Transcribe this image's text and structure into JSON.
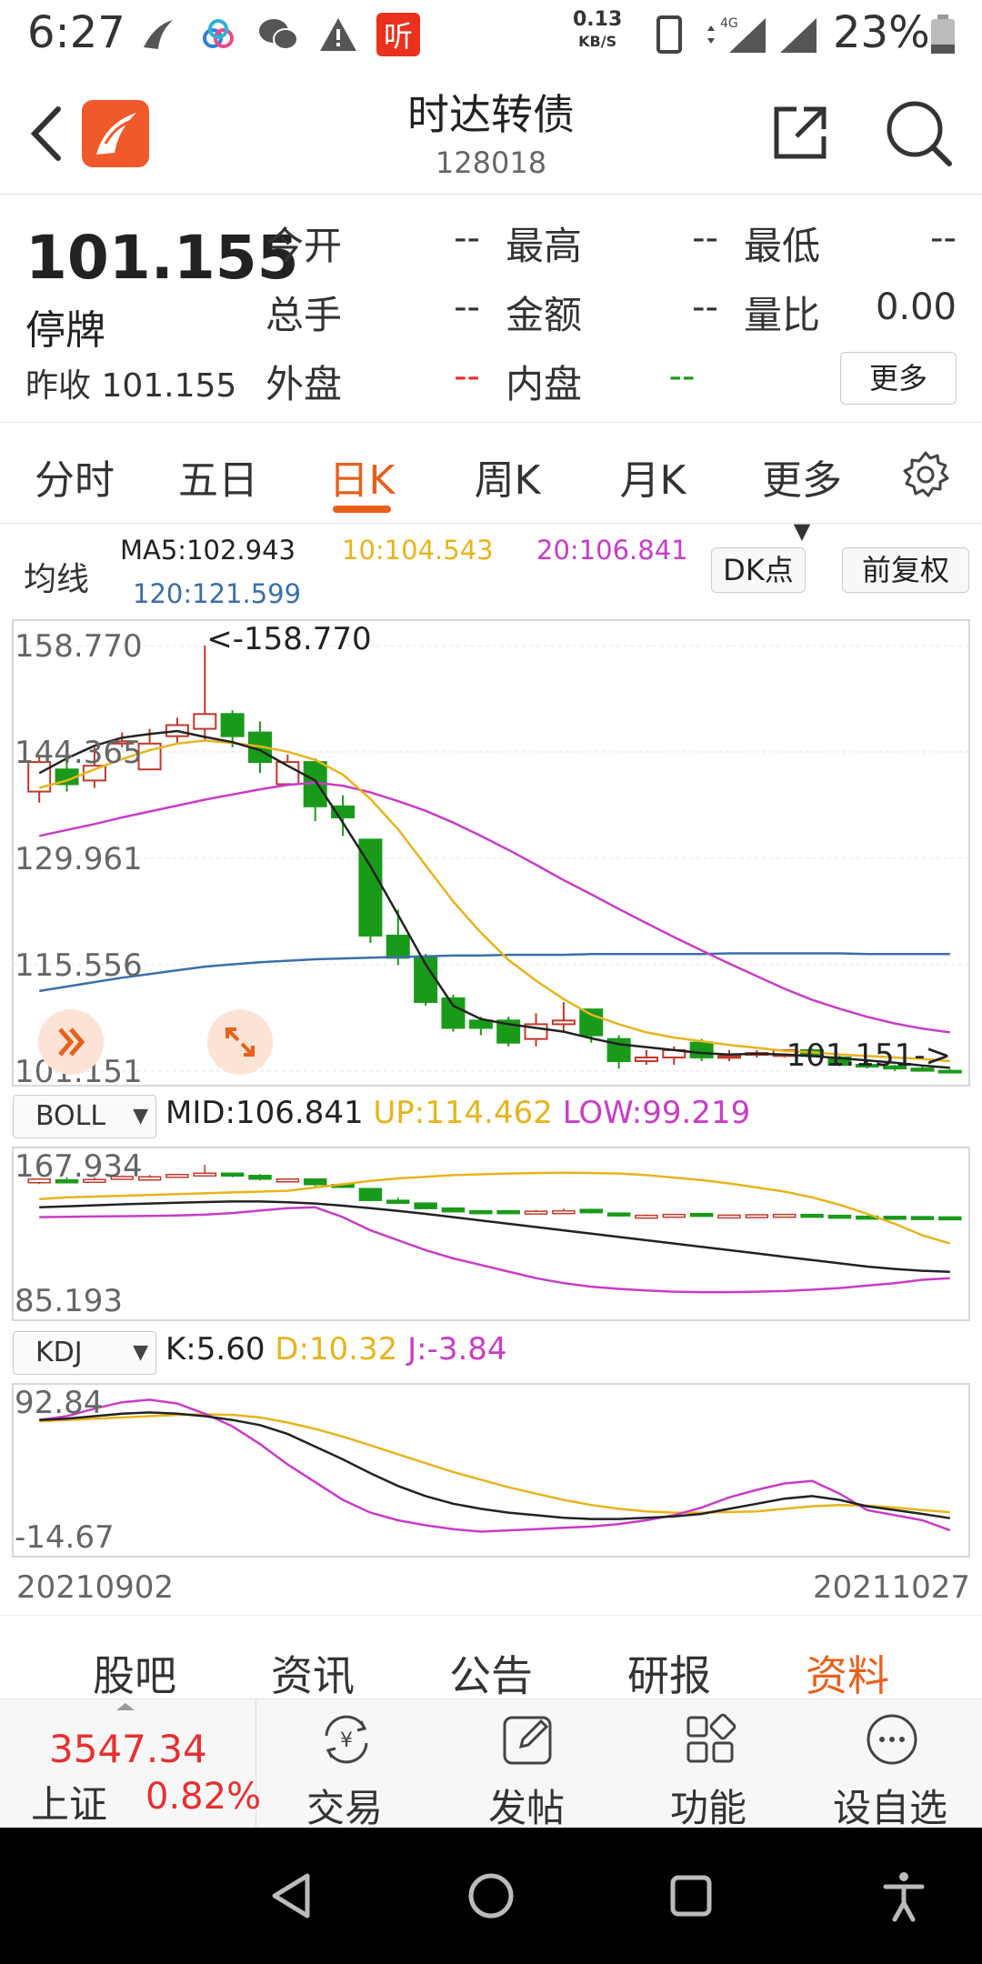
{
  "status_bar": {
    "time": "6:27",
    "notif_ting": "听",
    "net_speed_value": "0.13",
    "net_speed_unit": "KB/S",
    "network": "4G",
    "battery": "23%"
  },
  "header": {
    "title": "时达转债",
    "code": "128018"
  },
  "quote": {
    "price": "101.155",
    "status": "停牌",
    "prev_close_label": "昨收",
    "prev_close_value": "101.155",
    "fields": [
      {
        "label": "今开",
        "value": "--"
      },
      {
        "label": "最高",
        "value": "--"
      },
      {
        "label": "最低",
        "value": "--"
      },
      {
        "label": "总手",
        "value": "--"
      },
      {
        "label": "金额",
        "value": "--"
      },
      {
        "label": "量比",
        "value": "0.00"
      },
      {
        "label": "外盘",
        "value": "--"
      },
      {
        "label": "内盘",
        "value": "--"
      }
    ],
    "more_label": "更多"
  },
  "period_tabs": {
    "items": [
      "分时",
      "五日",
      "日K",
      "周K",
      "月K",
      "更多"
    ],
    "active": "日K"
  },
  "ma_legend": {
    "label": "均线",
    "ma5": "MA5:102.943",
    "ma10": "10:104.543",
    "ma20": "20:106.841",
    "ma120": "120:121.599",
    "dk_button": "DK点",
    "adjust_button": "前复权"
  },
  "colors": {
    "up": "#c0392b",
    "down": "#1a9a1a",
    "ma5": "#222222",
    "ma10": "#e8b41c",
    "ma20": "#c83cc8",
    "ma120": "#3b6fa8",
    "accent": "#e8601c"
  },
  "chart_data": [
    {
      "type": "candlestick",
      "name_label": "main",
      "y_ticks": [
        "158.770",
        "144.365",
        "129.961",
        "115.556",
        "101.151"
      ],
      "ylim": [
        101.151,
        158.77
      ],
      "max_annotation": "<-158.770",
      "min_annotation": "101.151->",
      "candles": [
        {
          "o": 139.0,
          "h": 144.0,
          "l": 137.5,
          "c": 143.0
        },
        {
          "o": 142.0,
          "h": 145.2,
          "l": 139.0,
          "c": 140.0
        },
        {
          "o": 140.5,
          "h": 145.0,
          "l": 139.5,
          "c": 142.5
        },
        {
          "o": 145.5,
          "h": 147.0,
          "l": 145.0,
          "c": 145.8
        },
        {
          "o": 142.0,
          "h": 147.5,
          "l": 142.0,
          "c": 145.5
        },
        {
          "o": 146.5,
          "h": 149.0,
          "l": 145.5,
          "c": 148.0
        },
        {
          "o": 147.5,
          "h": 158.77,
          "l": 146.0,
          "c": 149.5
        },
        {
          "o": 149.5,
          "h": 150.0,
          "l": 145.0,
          "c": 146.5
        },
        {
          "o": 147.0,
          "h": 148.5,
          "l": 141.5,
          "c": 143.0
        },
        {
          "o": 140.0,
          "h": 144.0,
          "l": 140.0,
          "c": 143.0
        },
        {
          "o": 143.0,
          "h": 143.5,
          "l": 135.0,
          "c": 137.0
        },
        {
          "o": 137.0,
          "h": 138.5,
          "l": 133.0,
          "c": 135.5
        },
        {
          "o": 132.5,
          "h": 132.5,
          "l": 118.5,
          "c": 119.5
        },
        {
          "o": 119.5,
          "h": 123.0,
          "l": 115.5,
          "c": 116.5
        },
        {
          "o": 116.5,
          "h": 117.0,
          "l": 110.0,
          "c": 110.5
        },
        {
          "o": 111.0,
          "h": 111.5,
          "l": 106.5,
          "c": 107.0
        },
        {
          "o": 108.0,
          "h": 108.5,
          "l": 106.0,
          "c": 107.0
        },
        {
          "o": 108.0,
          "h": 108.5,
          "l": 104.5,
          "c": 105.0
        },
        {
          "o": 105.5,
          "h": 109.0,
          "l": 104.5,
          "c": 107.5
        },
        {
          "o": 107.5,
          "h": 110.5,
          "l": 106.5,
          "c": 108.0
        },
        {
          "o": 109.5,
          "h": 109.5,
          "l": 105.0,
          "c": 106.0
        },
        {
          "o": 105.5,
          "h": 106.0,
          "l": 101.5,
          "c": 102.5
        },
        {
          "o": 102.5,
          "h": 104.0,
          "l": 102.0,
          "c": 103.0
        },
        {
          "o": 103.0,
          "h": 104.5,
          "l": 102.0,
          "c": 104.0
        },
        {
          "o": 105.0,
          "h": 105.5,
          "l": 102.5,
          "c": 103.0
        },
        {
          "o": 103.0,
          "h": 104.0,
          "l": 102.5,
          "c": 103.2
        },
        {
          "o": 103.5,
          "h": 104.0,
          "l": 103.0,
          "c": 103.6
        },
        {
          "o": 103.2,
          "h": 104.0,
          "l": 103.0,
          "c": 104.0
        },
        {
          "o": 104.0,
          "h": 104.2,
          "l": 103.0,
          "c": 103.2
        },
        {
          "o": 103.0,
          "h": 103.5,
          "l": 101.8,
          "c": 102.0
        },
        {
          "o": 102.0,
          "h": 102.5,
          "l": 101.5,
          "c": 101.8
        },
        {
          "o": 101.8,
          "h": 102.0,
          "l": 101.2,
          "c": 101.5
        },
        {
          "o": 101.5,
          "h": 101.8,
          "l": 101.151,
          "c": 101.2
        },
        {
          "o": 101.2,
          "h": 101.4,
          "l": 101.151,
          "c": 101.155
        }
      ],
      "ma5": [
        141.5,
        143.5,
        145.2,
        146.3,
        146.8,
        147.2,
        146.4,
        145.7,
        144.6,
        142.5,
        140.5,
        134.8,
        128.9,
        122.3,
        115.6,
        110.0,
        108.2,
        107.5,
        107.0,
        106.5,
        105.6,
        104.8,
        104.4,
        104.0,
        103.6,
        103.4,
        103.5,
        103.4,
        103.2,
        102.9,
        102.6,
        102.3,
        101.9,
        101.6
      ],
      "ma10": [
        139.5,
        140.5,
        142.0,
        143.4,
        144.6,
        145.5,
        145.9,
        145.6,
        145.1,
        144.4,
        143.3,
        141.3,
        138.0,
        133.9,
        129.0,
        124.1,
        119.9,
        116.2,
        113.4,
        110.9,
        108.8,
        107.5,
        106.4,
        105.7,
        105.2,
        104.7,
        104.3,
        103.9,
        103.7,
        103.4,
        103.2,
        103.0,
        102.8,
        102.5
      ],
      "ma20": [
        133.0,
        133.8,
        134.6,
        135.5,
        136.3,
        137.1,
        137.9,
        138.6,
        139.3,
        139.9,
        140.2,
        139.8,
        138.9,
        137.7,
        136.4,
        134.8,
        133.0,
        131.1,
        129.1,
        127.0,
        125.1,
        123.1,
        121.2,
        119.3,
        117.5,
        115.7,
        114.0,
        112.3,
        110.8,
        109.6,
        108.5,
        107.6,
        106.9,
        106.4
      ],
      "ma120": [
        112.0,
        112.6,
        113.2,
        113.8,
        114.3,
        114.8,
        115.3,
        115.6,
        115.9,
        116.1,
        116.3,
        116.4,
        116.5,
        116.6,
        116.7,
        116.8,
        116.8,
        116.9,
        116.9,
        116.9,
        117.0,
        117.0,
        117.0,
        117.0,
        117.0,
        117.1,
        117.1,
        117.1,
        117.1,
        117.1,
        117.0,
        117.0,
        117.0,
        117.0
      ]
    },
    {
      "type": "line",
      "indicator": "BOLL",
      "label_mid": "MID:106.841",
      "label_up": "UP:114.462",
      "label_low": "LOW:99.219",
      "y_ticks": [
        "167.934",
        "85.193"
      ],
      "ylim": [
        85.193,
        167.934
      ],
      "up": [
        151,
        152,
        152.5,
        153,
        153.5,
        154,
        154.5,
        155,
        155.5,
        156,
        158,
        160,
        162,
        163.5,
        164.5,
        165.5,
        166,
        166.5,
        166.8,
        167,
        166.8,
        166.5,
        165.5,
        164,
        162.5,
        160.5,
        158,
        155.5,
        152,
        147.5,
        142,
        136,
        129,
        124
      ],
      "mid": [
        146,
        146.6,
        147.2,
        147.8,
        148.3,
        148.8,
        149.2,
        149.5,
        149.5,
        149,
        148.3,
        147,
        145.5,
        143.8,
        142,
        140,
        138,
        136,
        134,
        132,
        130,
        128,
        126,
        124,
        122,
        120,
        118,
        116,
        114,
        112,
        110,
        108.6,
        107.5,
        106.8
      ],
      "low": [
        140,
        140.2,
        140.4,
        140.6,
        140.8,
        141,
        141.5,
        142.5,
        144,
        145.5,
        146,
        140,
        132,
        126,
        120,
        115,
        111,
        107,
        103,
        100,
        97.8,
        96.5,
        95.5,
        94.8,
        94.5,
        94.5,
        94.8,
        95.2,
        96,
        97,
        98.5,
        100,
        102,
        103
      ]
    },
    {
      "type": "line",
      "indicator": "KDJ",
      "label_k": "K:5.60",
      "label_d": "D:10.32",
      "label_j": "J:-3.84",
      "y_ticks": [
        "92.84",
        "-14.67"
      ],
      "ylim": [
        -14.67,
        92.84
      ],
      "k": [
        83,
        84,
        86,
        88,
        89,
        88,
        86,
        83,
        79,
        72,
        62,
        52,
        41,
        31,
        23,
        17,
        13,
        10,
        8,
        6,
        5,
        5,
        6,
        7,
        9,
        13,
        17,
        21,
        23,
        20,
        15,
        12,
        9,
        5.6
      ],
      "d": [
        82,
        83,
        84,
        85,
        86,
        87,
        87.5,
        87,
        85,
        81,
        76,
        70,
        63,
        56,
        49,
        42,
        36,
        30,
        25,
        20,
        16,
        13,
        11,
        10,
        10,
        10.5,
        11,
        13,
        15,
        16,
        15.5,
        14,
        12,
        10.32
      ],
      "j": [
        83,
        86,
        92,
        97,
        99,
        96,
        88,
        78,
        64,
        48,
        34,
        20,
        10,
        4,
        0,
        -3,
        -5,
        -4,
        -3,
        -2,
        -1,
        1,
        4,
        8,
        14,
        22,
        28,
        33,
        35,
        25,
        12,
        8,
        4,
        -3.84
      ]
    }
  ],
  "dates": {
    "start": "20210902",
    "end": "20211027"
  },
  "boll_selector": "BOLL",
  "kdj_selector": "KDJ",
  "info_tabs": {
    "items": [
      "股吧",
      "资讯",
      "公告",
      "研报",
      "资料"
    ],
    "active": "资料"
  },
  "toolbar": {
    "index_value": "3547.34",
    "index_name": "上证",
    "index_change": "0.82%",
    "tools": [
      {
        "label": "交易",
        "icon": "yuan-exchange-icon"
      },
      {
        "label": "发帖",
        "icon": "edit-icon"
      },
      {
        "label": "功能",
        "icon": "grid-icon"
      },
      {
        "label": "设自选",
        "icon": "more-dots-icon"
      }
    ]
  },
  "navbar": {
    "icons": [
      "back-triangle-icon",
      "home-circle-icon",
      "recents-square-icon",
      "accessibility-icon"
    ]
  }
}
